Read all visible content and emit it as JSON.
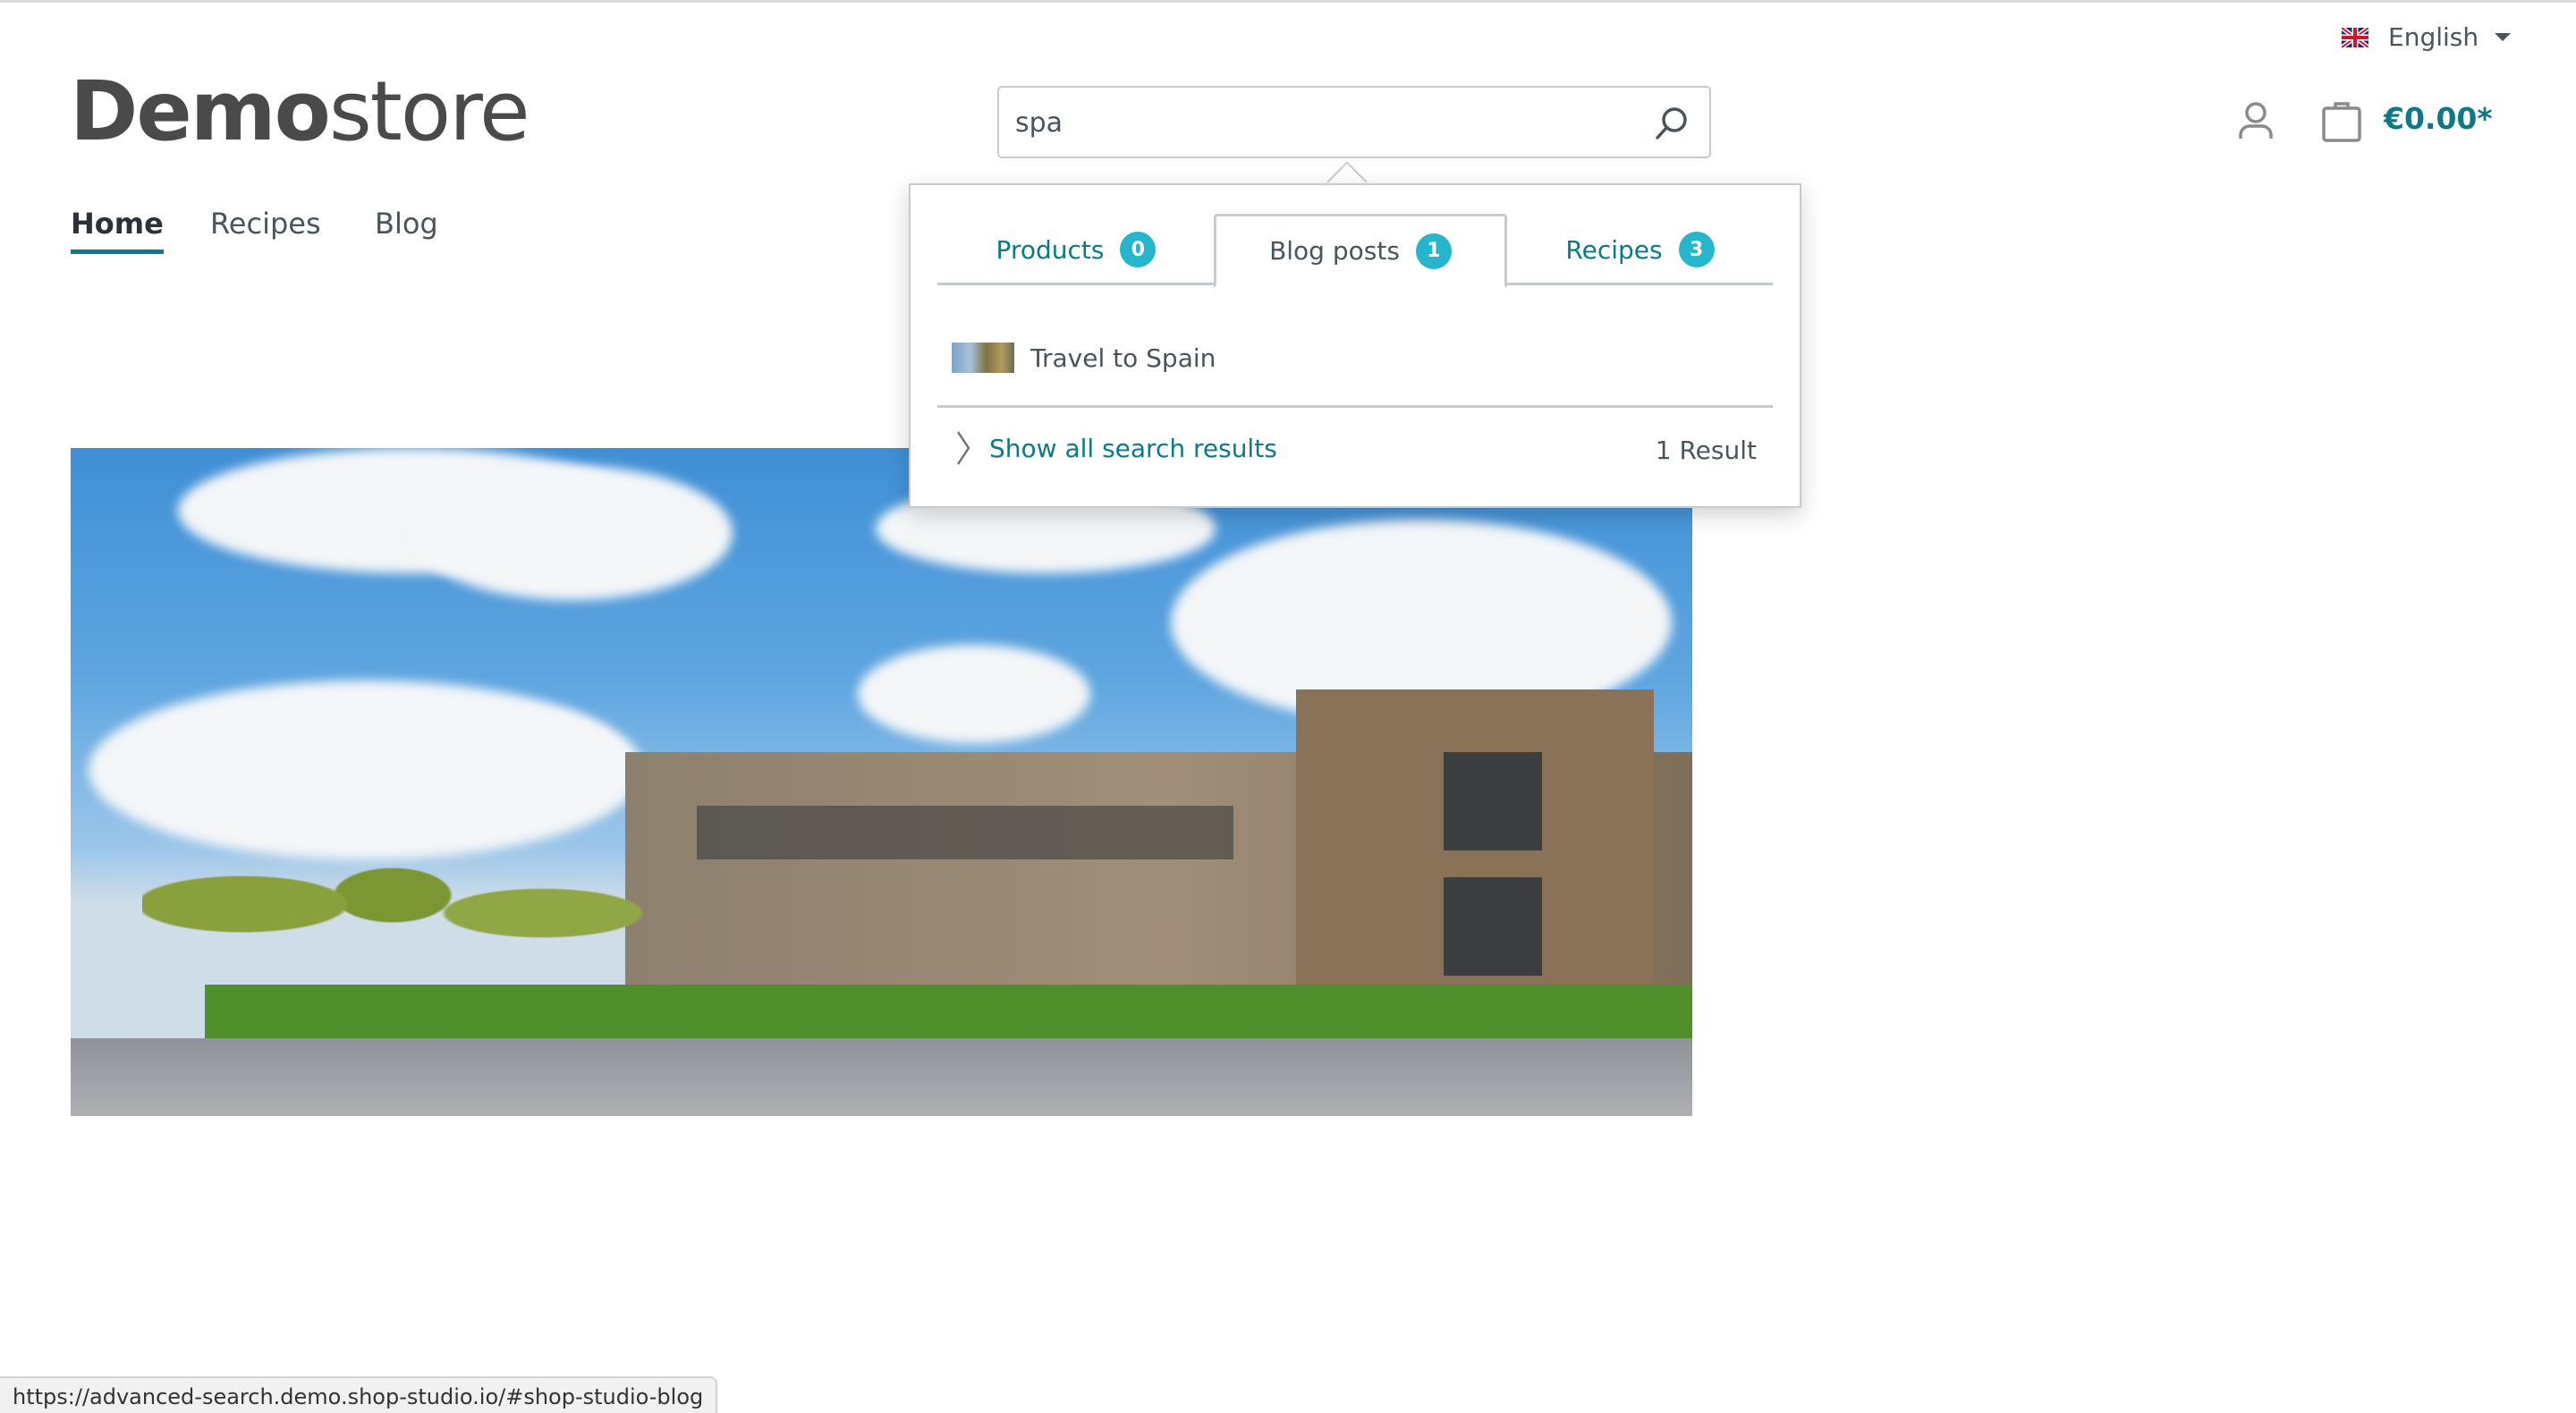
{
  "header": {
    "logo_bold": "Demo",
    "logo_light": "store",
    "language": {
      "label": "English",
      "flag": "uk-flag-icon"
    },
    "cart_total": "€0.00*",
    "icons": {
      "account": "user-icon",
      "cart": "shopping-bag-icon",
      "search": "search-icon"
    }
  },
  "nav": {
    "items": [
      {
        "label": "Home",
        "active": true
      },
      {
        "label": "Recipes"
      },
      {
        "label": "Blog"
      }
    ]
  },
  "search": {
    "value": "spa",
    "dropdown": {
      "tabs": [
        {
          "label": "Products",
          "count": "0"
        },
        {
          "label": "Blog posts",
          "count": "1",
          "active": true
        },
        {
          "label": "Recipes",
          "count": "3"
        }
      ],
      "results": [
        {
          "title": "Travel to Spain"
        }
      ],
      "show_all_label": "Show all search results",
      "result_count": "1 Result"
    }
  },
  "status_bar": {
    "url": "https://advanced-search.demo.shop-studio.io/#shop-studio-blog"
  },
  "colors": {
    "accent": "#0b7a86",
    "badge": "#25b6ce",
    "text": "#4a545b"
  }
}
